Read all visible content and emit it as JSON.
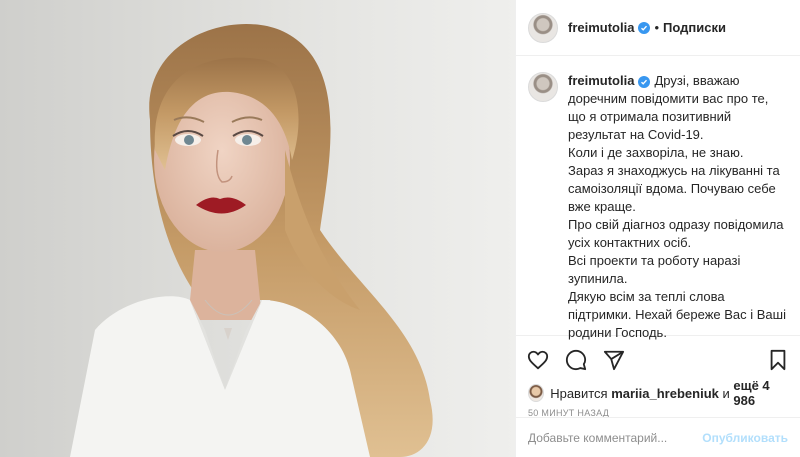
{
  "post": {
    "photo_alt": "",
    "author": {
      "username": "freimutolia",
      "verified": true,
      "verified_icon": "verified-badge-icon"
    },
    "header": {
      "separator": "•",
      "follow_label": "Подписки"
    },
    "caption": {
      "lines": [
        "Друзі, вважаю доречним повідомити вас про те, що я отримала позитивний результат на Covid-19.",
        "Коли і де захворіла, не знаю.",
        "Зараз я знаходжусь на лікуванні та самоізоляції вдома. Почуваю себе вже краще.",
        "Про свій діагноз одразу повідомила усіх контактних осіб.",
        "Всі проекти та роботу наразі зупинила.",
        "Дякую всім за теплі слова підтримки. Нехай береже Вас і Ваші родини Господь."
      ]
    },
    "actions": {
      "like_icon": "heart-icon",
      "comment_icon": "comment-icon",
      "share_icon": "share-icon",
      "save_icon": "bookmark-icon"
    },
    "likes": {
      "prefix": "Нравится",
      "liker": "mariia_hrebeniuk",
      "connector": "и",
      "others": "ещё 4 986"
    },
    "timestamp": "50 минут назад",
    "comment": {
      "placeholder": "Добавьте комментарий...",
      "value": "",
      "publish_label": "Опубликовать"
    },
    "colors": {
      "verified": "#3897f0",
      "publish_disabled": "#b2dffc",
      "lips": "#9e1b24",
      "hair": "#b88a56",
      "shirt": "#f4f4f2"
    }
  }
}
